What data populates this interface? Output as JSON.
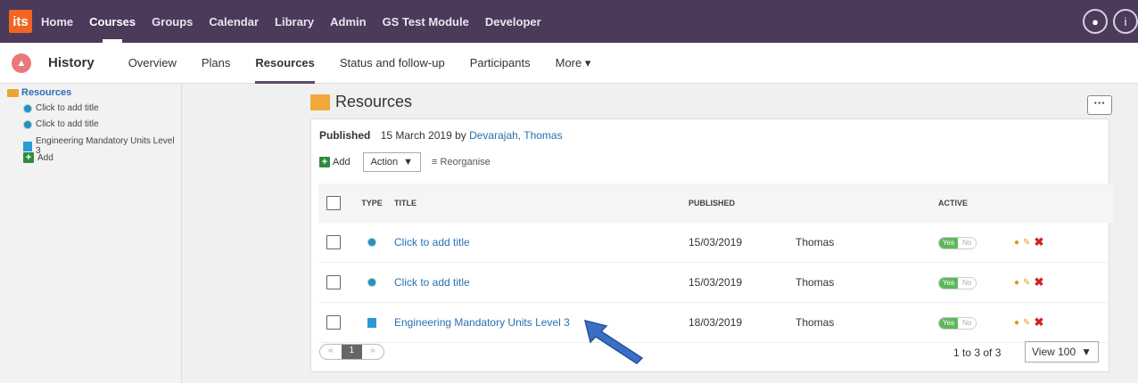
{
  "nav": {
    "logo": "its",
    "items": [
      "Home",
      "Courses",
      "Groups",
      "Calendar",
      "Library",
      "Admin",
      "GS Test Module",
      "Developer"
    ],
    "active": "Courses"
  },
  "course": {
    "title": "History",
    "tabs": [
      "Overview",
      "Plans",
      "Resources",
      "Status and follow-up",
      "Participants",
      "More ▾"
    ],
    "active_tab": "Resources"
  },
  "tree": {
    "root": "Resources",
    "items": [
      "Click to add title",
      "Click to add title",
      "Engineering Mandatory Units Level 3"
    ],
    "add": "Add"
  },
  "main": {
    "heading": "Resources",
    "more_label": "···",
    "published_label": "Published",
    "published_date": "15 March 2019 by",
    "published_author": "Devarajah, Thomas",
    "add_label": "Add",
    "action_label": "Action",
    "reorganise_label": "Reorganise"
  },
  "table": {
    "headers": {
      "type": "TYPE",
      "title": "TITLE",
      "published": "PUBLISHED",
      "active": "ACTIVE"
    },
    "rows": [
      {
        "title": "Click to add title",
        "published": "15/03/2019",
        "user": "Thomas",
        "yes": "Yes",
        "no": "No"
      },
      {
        "title": "Click to add title",
        "published": "15/03/2019",
        "user": "Thomas",
        "yes": "Yes",
        "no": "No"
      },
      {
        "title": "Engineering Mandatory Units Level 3",
        "published": "18/03/2019",
        "user": "Thomas",
        "yes": "Yes",
        "no": "No"
      }
    ]
  },
  "pager": {
    "prev": "«",
    "page": "1",
    "next": "»",
    "count": "1 to 3 of 3",
    "view": "View 100"
  },
  "colors": {
    "topnav": "#4b3a5a",
    "link": "#2a6fb5",
    "arrow": "#3b6fc6"
  }
}
